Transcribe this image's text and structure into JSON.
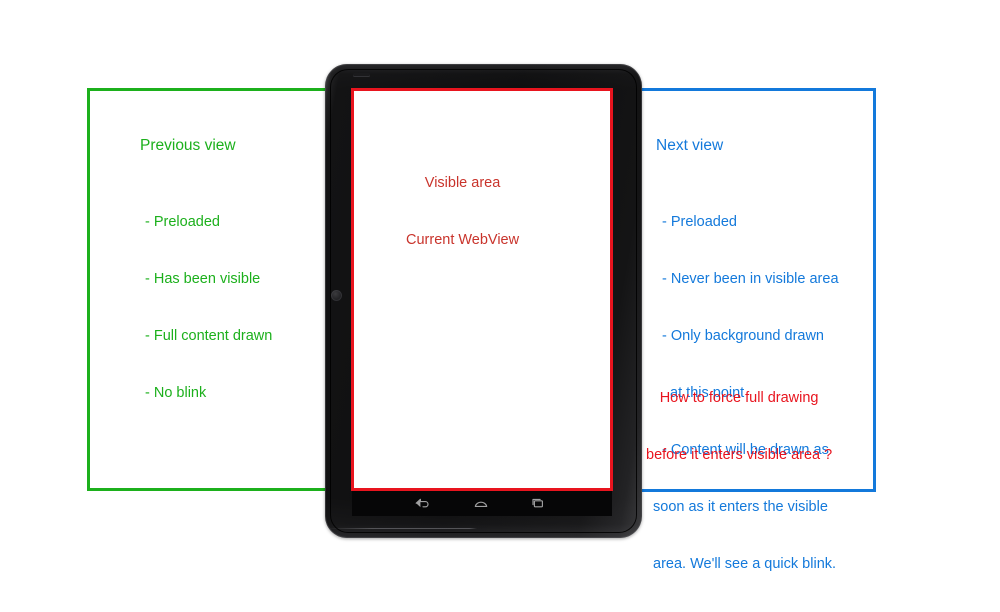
{
  "diagram": {
    "background_color": "#ffffff",
    "colors": {
      "previous": "#1cb01c",
      "visible": "#e8141e",
      "next": "#1379db",
      "question": "#e8141e",
      "visible_label": "#c9342c",
      "device_body": "#0e0e0f",
      "screen": "#ffffff"
    }
  },
  "previous_panel": {
    "title": "Previous view",
    "bullets": [
      "- Preloaded",
      "- Has been visible",
      "- Full content drawn",
      "- No blink"
    ]
  },
  "visible_panel": {
    "line1": "Visible area",
    "line2": "Current WebView"
  },
  "next_panel": {
    "title": "Next view",
    "bullets": [
      "- Preloaded",
      "- Never been in visible area",
      "- Only background drawn",
      "  at this point",
      "- Content will be drawn as",
      "soon as it enters the visible",
      "area. We'll see a quick blink."
    ],
    "question_line1": "How to force full drawing",
    "question_line2": "before it enters visible area ?"
  },
  "device": {
    "type": "android-tablet",
    "navbar": {
      "back_label": "back-icon",
      "home_label": "home-icon",
      "recents_label": "recents-icon"
    }
  }
}
